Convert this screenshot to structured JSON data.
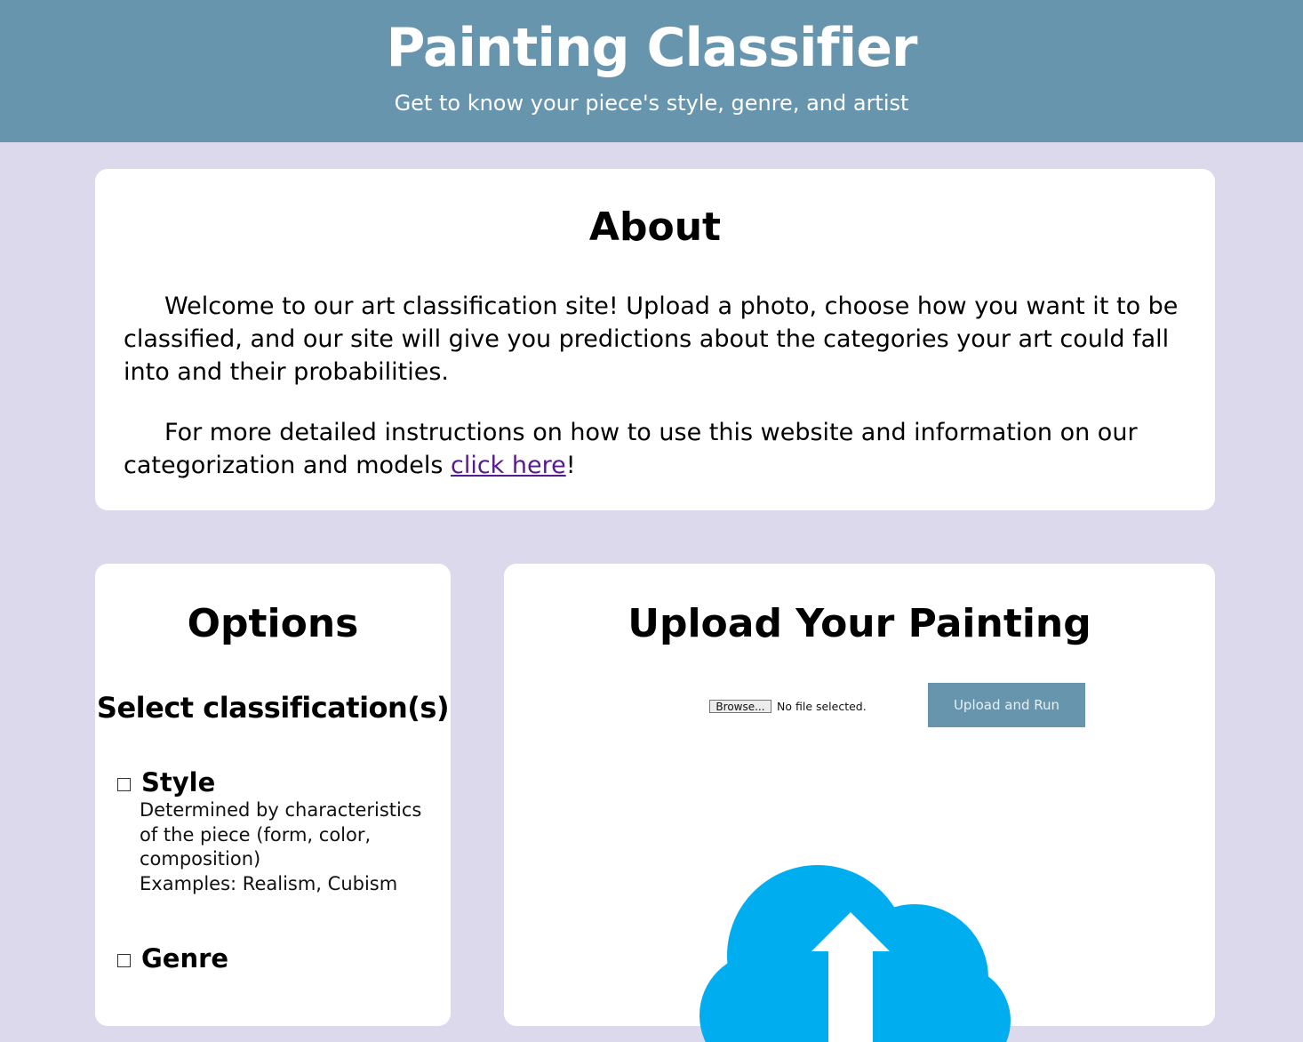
{
  "header": {
    "title": "Painting Classifier",
    "subtitle": "Get to know your piece's style, genre, and artist"
  },
  "about": {
    "title": "About",
    "paragraph1": "Welcome to our art classification site! Upload a photo, choose how you want it to be classified, and our site will give you predictions about the categories your art could fall into and their probabilities.",
    "paragraph2_before_link": "For more detailed instructions on how to use this website and information on our categorization and models ",
    "link_text": "click here",
    "paragraph2_after_link": "!"
  },
  "options": {
    "title": "Options",
    "subtitle": "Select classification(s)",
    "items": [
      {
        "label": "Style",
        "description": "Determined by characteristics of the piece (form, color, composition)",
        "examples": "Examples: Realism, Cubism",
        "checked": false
      },
      {
        "label": "Genre",
        "checked": false
      }
    ]
  },
  "upload": {
    "title": "Upload Your Painting",
    "browse_label": "Browse...",
    "file_status": "No file selected.",
    "run_label": "Upload and Run",
    "icon": "cloud-upload-icon",
    "icon_color": "#00aeef"
  },
  "colors": {
    "header_bg": "#6795ad",
    "page_bg": "#dcd9ec",
    "card_bg": "#ffffff",
    "link": "#551a8b",
    "button_bg": "#6795ad"
  }
}
